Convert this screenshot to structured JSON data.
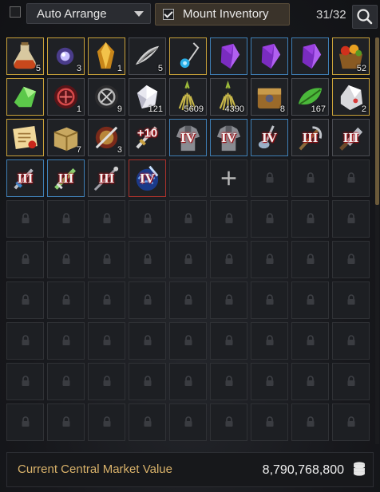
{
  "topbar": {
    "auto_arrange_checked": false,
    "auto_arrange_label": "Auto Arrange",
    "mount_inventory_checked": true,
    "mount_inventory_label": "Mount Inventory",
    "slot_count": "31/32",
    "search_icon": "search-icon"
  },
  "colors": {
    "gold_border": "#c9a23a",
    "blue_border": "#3f7fb5",
    "red_border": "#a8322c",
    "market_label": "#d9b26a"
  },
  "items": [
    {
      "icon": "potion-bottle-icon",
      "frame": "gold",
      "qty": "5",
      "badge": ""
    },
    {
      "icon": "glowing-orb-icon",
      "frame": "gold",
      "qty": "3",
      "badge": ""
    },
    {
      "icon": "amber-crystal-icon",
      "frame": "gold",
      "qty": "1",
      "badge": ""
    },
    {
      "icon": "black-stone-icon",
      "frame": "plain",
      "qty": "5",
      "badge": ""
    },
    {
      "icon": "blue-pendant-icon",
      "frame": "gold",
      "qty": "",
      "badge": ""
    },
    {
      "icon": "purple-crystal-icon",
      "frame": "blue",
      "qty": "",
      "badge": ""
    },
    {
      "icon": "purple-crystal-icon",
      "frame": "blue",
      "qty": "",
      "badge": ""
    },
    {
      "icon": "purple-crystal-icon",
      "frame": "blue",
      "qty": "",
      "badge": ""
    },
    {
      "icon": "fruit-basket-icon",
      "frame": "gold",
      "qty": "52",
      "badge": ""
    },
    {
      "icon": "green-crystal-icon",
      "frame": "gold",
      "qty": "",
      "badge": ""
    },
    {
      "icon": "red-rune-icon",
      "frame": "plain",
      "qty": "1",
      "badge": ""
    },
    {
      "icon": "gray-rune-icon",
      "frame": "plain",
      "qty": "9",
      "badge": ""
    },
    {
      "icon": "white-gem-icon",
      "frame": "plain",
      "qty": "121",
      "badge": ""
    },
    {
      "icon": "herb-bundle-icon",
      "frame": "plain",
      "qty": "5609",
      "badge": ""
    },
    {
      "icon": "herb-bundle-icon",
      "frame": "plain",
      "qty": "4390",
      "badge": ""
    },
    {
      "icon": "treasure-box-icon",
      "frame": "plain",
      "qty": "8",
      "badge": ""
    },
    {
      "icon": "green-leaf-icon",
      "frame": "plain",
      "qty": "167",
      "badge": ""
    },
    {
      "icon": "silver-stone-icon",
      "frame": "gold",
      "qty": "2",
      "badge": ""
    },
    {
      "icon": "scroll-icon",
      "frame": "gold",
      "qty": "",
      "badge": ""
    },
    {
      "icon": "crate-icon",
      "frame": "plain",
      "qty": "7",
      "badge": ""
    },
    {
      "icon": "shield-sword-icon",
      "frame": "plain",
      "qty": "3",
      "badge": ""
    },
    {
      "icon": "sword-icon",
      "frame": "plain",
      "qty": "",
      "badge": "+10"
    },
    {
      "icon": "armor-icon",
      "frame": "blue",
      "qty": "",
      "badge": "IV"
    },
    {
      "icon": "armor-icon",
      "frame": "blue",
      "qty": "",
      "badge": "IV"
    },
    {
      "icon": "ladle-icon",
      "frame": "blue",
      "qty": "",
      "badge": "IV"
    },
    {
      "icon": "sickle-icon",
      "frame": "plain",
      "qty": "",
      "badge": "III"
    },
    {
      "icon": "cleaver-icon",
      "frame": "plain",
      "qty": "",
      "badge": "III"
    },
    {
      "icon": "dagger-icon",
      "frame": "blue",
      "qty": "",
      "badge": "III"
    },
    {
      "icon": "green-blade-icon",
      "frame": "blue",
      "qty": "",
      "badge": "III"
    },
    {
      "icon": "rod-icon",
      "frame": "plain",
      "qty": "",
      "badge": "III"
    },
    {
      "icon": "blue-vortex-icon",
      "frame": "red",
      "qty": "",
      "badge": "IV"
    }
  ],
  "add_slot_icon": "plus-icon",
  "locked_slot_icon": "lock-icon",
  "footer": {
    "label": "Current Central Market Value",
    "value": "8,790,768,800",
    "coin_icon": "coin-stack-icon"
  }
}
